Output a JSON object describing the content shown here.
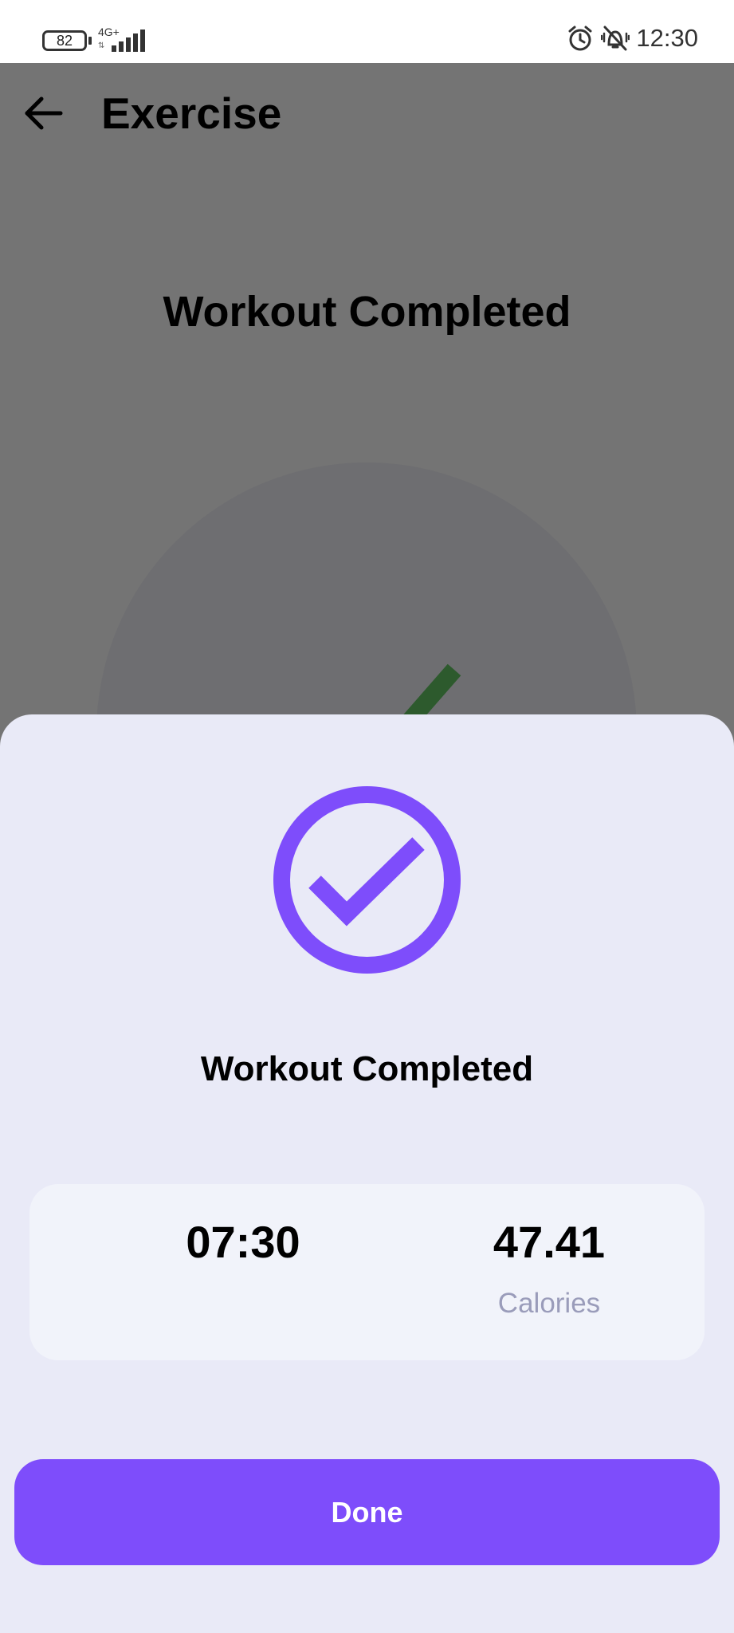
{
  "status_bar": {
    "battery": "82",
    "network": "4G+",
    "time": "12:30",
    "icons": [
      "battery-icon",
      "signal-icon",
      "alarm-icon",
      "vibrate-off-icon"
    ]
  },
  "header": {
    "title": "Exercise",
    "back_icon": "back-arrow-icon"
  },
  "background_screen": {
    "heading": "Workout Completed"
  },
  "sheet": {
    "title": "Workout Completed",
    "icon": "check-circle-icon",
    "stats": [
      {
        "value": "07:30",
        "label": ""
      },
      {
        "value": "47.41",
        "label": "Calories"
      }
    ],
    "done_label": "Done"
  },
  "colors": {
    "accent": "#7e4dfb",
    "sheet_background": "#e9eaf7",
    "card_background": "#f1f3fa",
    "muted_label": "#9a9cba",
    "overlay": "#747474"
  }
}
